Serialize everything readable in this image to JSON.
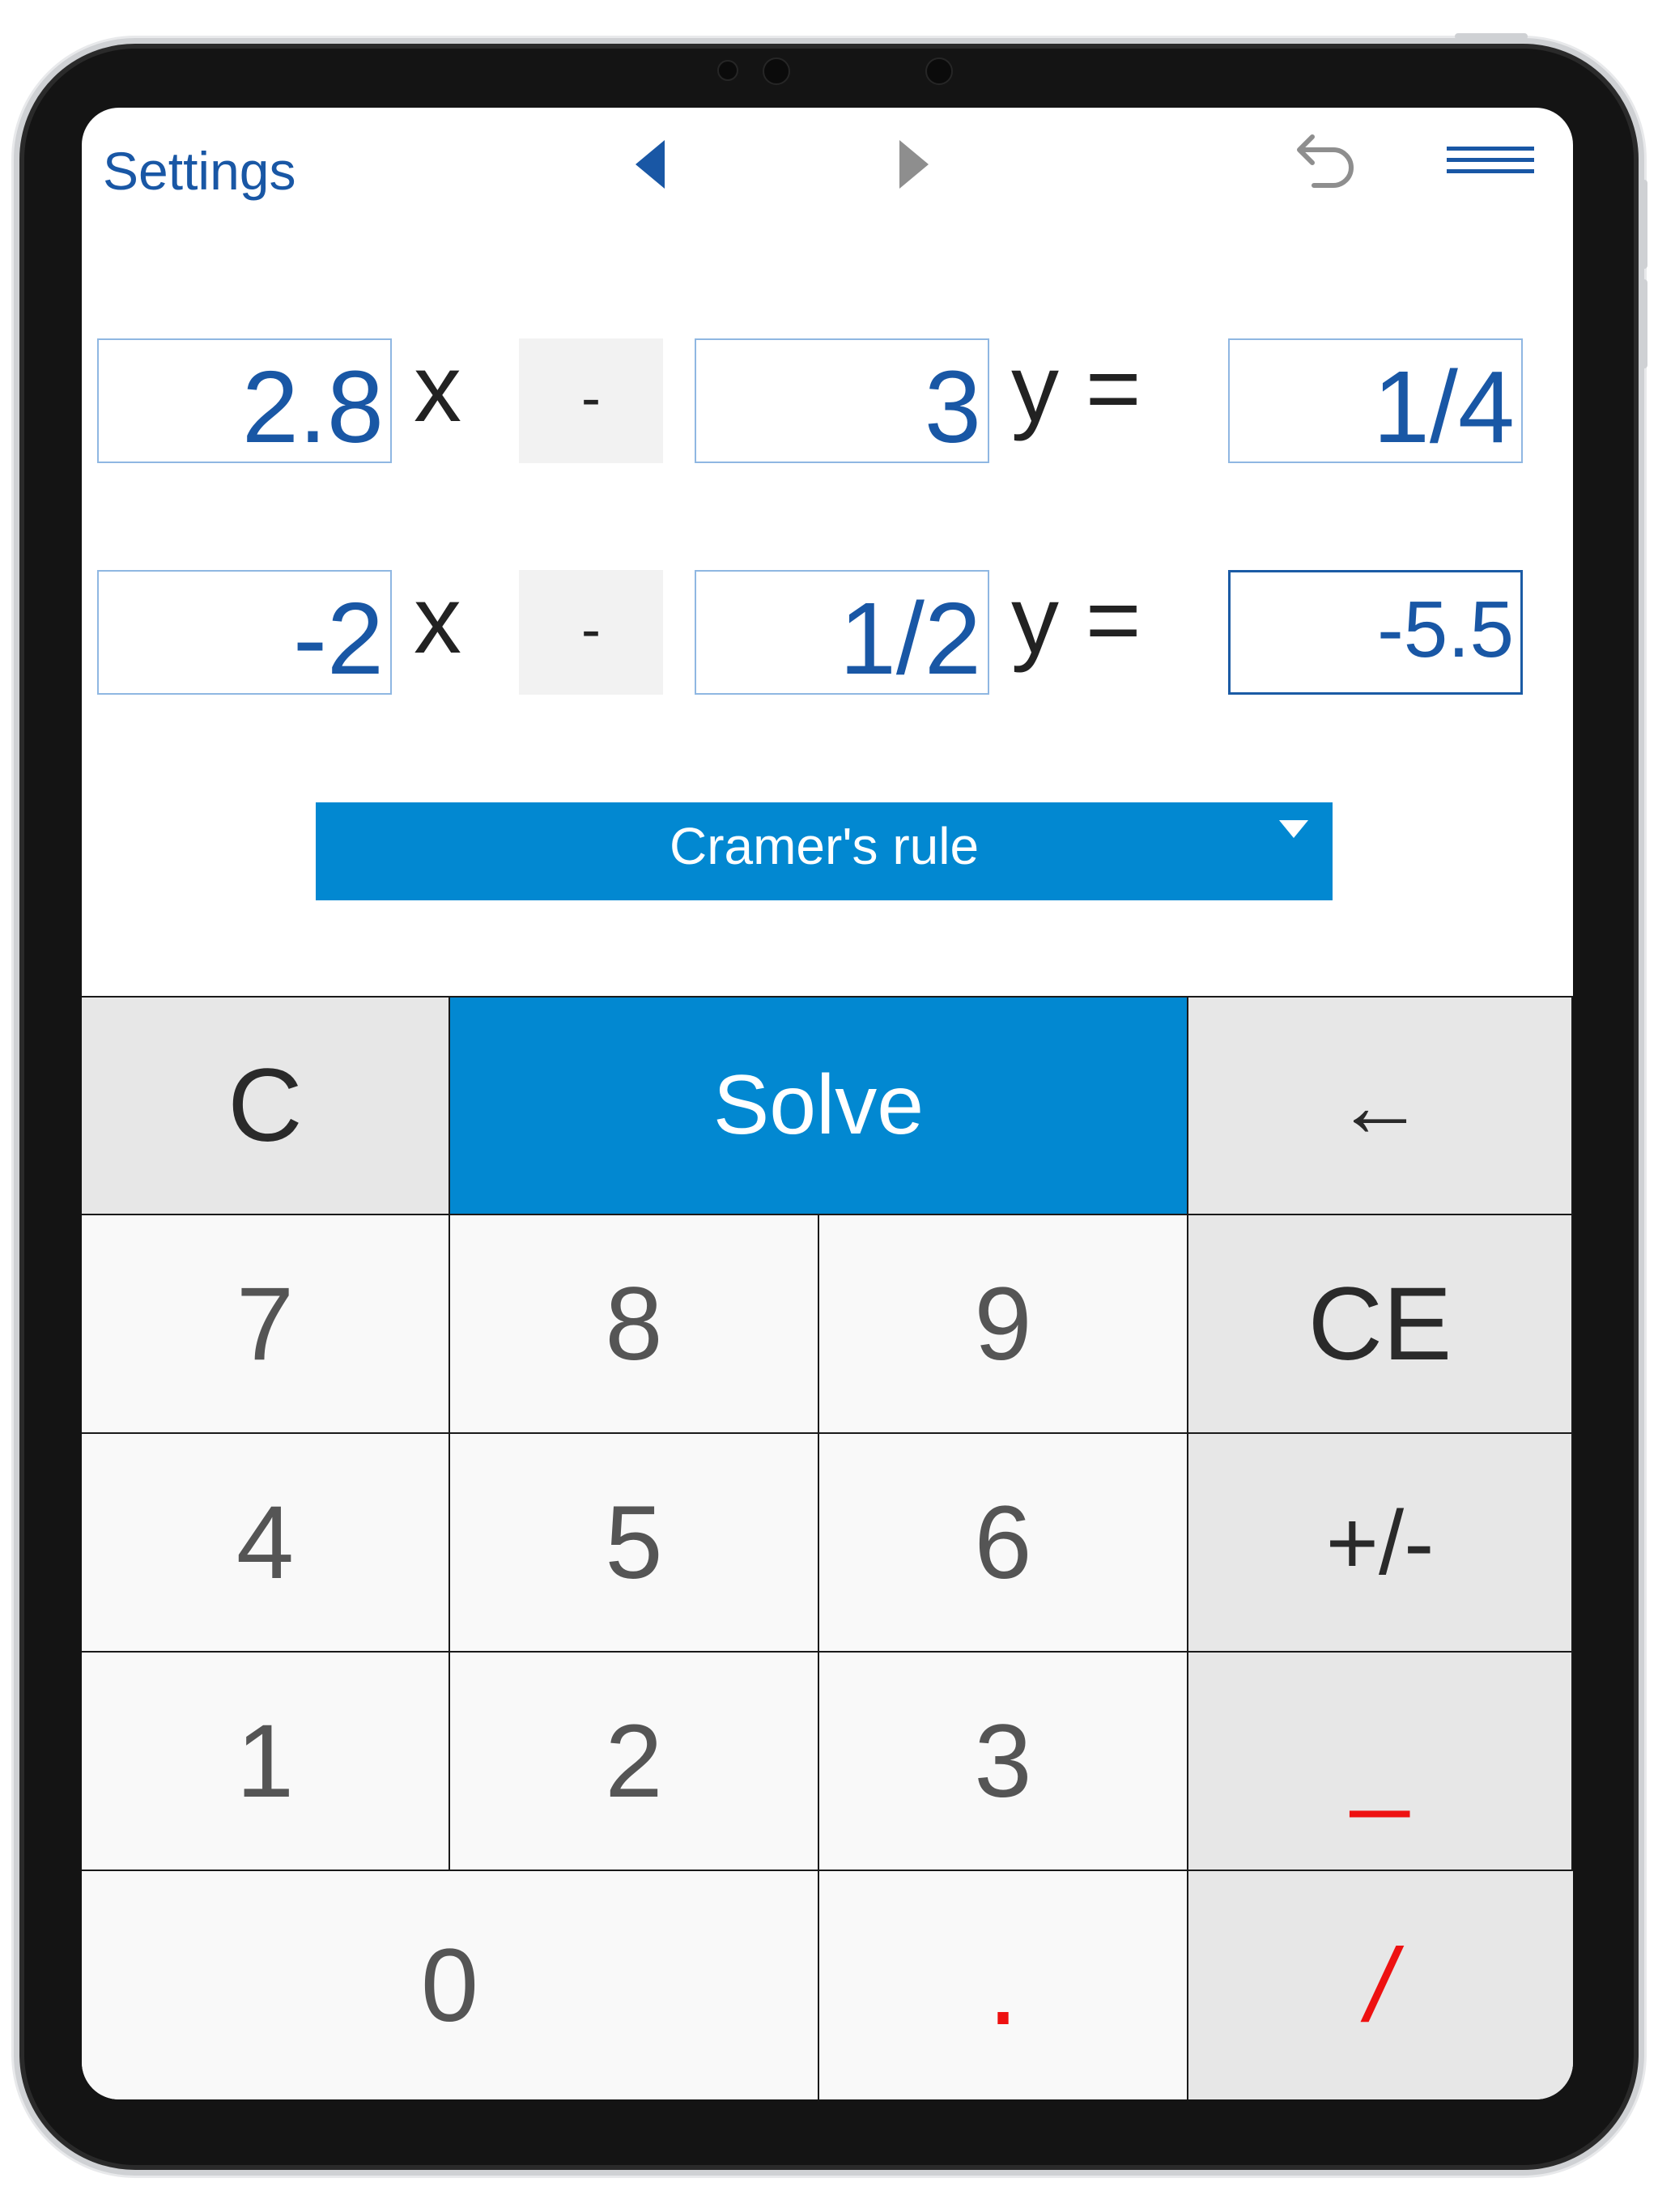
{
  "header": {
    "settings_label": "Settings",
    "icons": [
      "back-arrow-icon",
      "forward-arrow-icon",
      "undo-icon",
      "menu-icon"
    ]
  },
  "equations": [
    {
      "a": "2.8",
      "x_label": "x",
      "sign": "-",
      "b": "3",
      "y_label": "y =",
      "c": "1/4"
    },
    {
      "a": "-2",
      "x_label": "x",
      "sign": "-",
      "b": "1/2",
      "y_label": "y =",
      "c": "-5.5"
    }
  ],
  "method": {
    "selected": "Cramer's rule"
  },
  "keypad": {
    "clear": "C",
    "solve": "Solve",
    "backspace": "←",
    "k7": "7",
    "k8": "8",
    "k9": "9",
    "clear_entry": "CE",
    "k4": "4",
    "k5": "5",
    "k6": "6",
    "plus_minus": "+/-",
    "k1": "1",
    "k2": "2",
    "k3": "3",
    "fraction_bar": "_",
    "k0": "0",
    "decimal": ".",
    "slash": "/"
  },
  "colors": {
    "accent_blue": "#0288d1",
    "link_blue": "#1957a5",
    "red_key": "#ee1111"
  }
}
